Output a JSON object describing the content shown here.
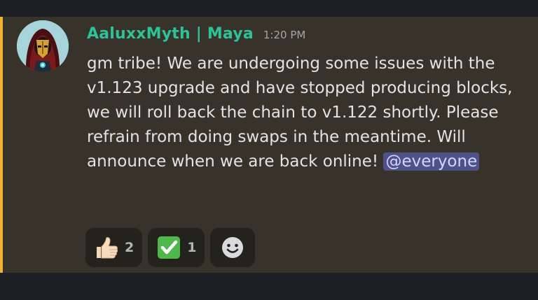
{
  "message": {
    "author": "AaluxxMyth | Maya",
    "timestamp": "1:20 PM",
    "text": "gm tribe! We are undergoing some issues with the v1.123 upgrade and have stopped producing blocks, we will roll back the chain to v1.122 shortly. Please refrain from doing swaps in the meantime. Will announce when we are back online!",
    "mention": "@everyone",
    "avatar_icon": "hooded-figure-avatar-icon"
  },
  "reactions": [
    {
      "emoji_name": "thumbs-up-icon",
      "count": "2"
    },
    {
      "emoji_name": "check-mark-button-icon",
      "count": "1"
    }
  ],
  "add_reaction_icon": "smiley-face-icon",
  "colors": {
    "background": "#1e1f23",
    "message_highlight": "#37332a",
    "highlight_bar": "#f0b232",
    "username": "#2dc29a",
    "mention_bg": "#4e5289",
    "reaction_bg": "#24221d"
  }
}
